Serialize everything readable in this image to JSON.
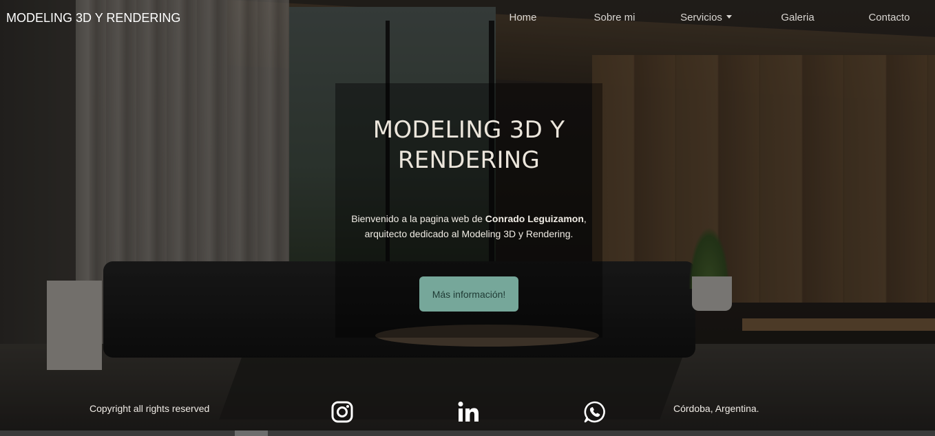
{
  "navbar": {
    "brand": "MODELING 3D Y RENDERING",
    "links": [
      {
        "label": "Home"
      },
      {
        "label": "Sobre mi"
      },
      {
        "label": "Servicios"
      },
      {
        "label": "Galeria"
      },
      {
        "label": "Contacto"
      }
    ]
  },
  "hero": {
    "title": "MODELING 3D Y RENDERING",
    "intro_prefix": "Bienvenido a la pagina web de ",
    "intro_name": "Conrado Leguizamon",
    "intro_suffix": ", arquitecto dedicado al Modeling 3D y Rendering.",
    "button_label": "Más información!",
    "button_color": "#76a79a"
  },
  "footer": {
    "copyright": "Copyright all rights reserved",
    "location": "Córdoba, Argentina.",
    "social_icons": [
      "instagram-icon",
      "linkedin-icon",
      "whatsapp-icon"
    ]
  }
}
